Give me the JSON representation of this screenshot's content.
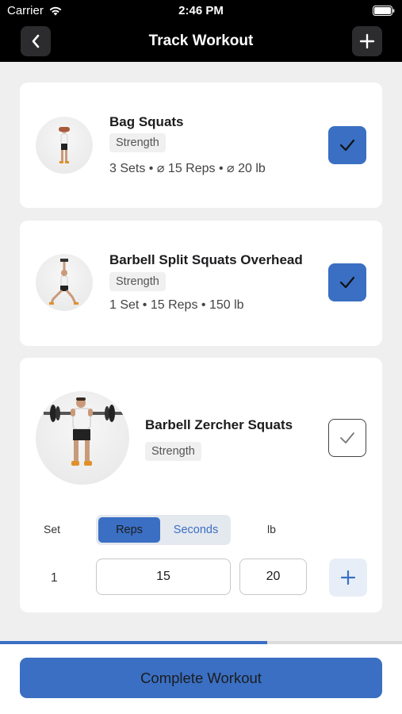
{
  "status_bar": {
    "carrier": "Carrier",
    "time": "2:46 PM"
  },
  "nav": {
    "title": "Track Workout"
  },
  "exercises": [
    {
      "name": "Bag Squats",
      "category": "Strength",
      "stats": "3 Sets • ⌀ 15 Reps • ⌀ 20 lb",
      "completed": true
    },
    {
      "name": "Barbell Split Squats Overhead",
      "category": "Strength",
      "stats": "1 Set • 15 Reps • 150 lb",
      "completed": true
    },
    {
      "name": "Barbell Zercher Squats",
      "category": "Strength",
      "completed": false,
      "sets_table": {
        "headers": {
          "set": "Set",
          "reps": "Reps",
          "seconds": "Seconds",
          "weight_unit": "lb"
        },
        "mode_selected": "Reps",
        "rows": [
          {
            "set": "1",
            "reps": "15",
            "weight": "20"
          }
        ]
      }
    }
  ],
  "progress": 0.665,
  "footer": {
    "complete_label": "Complete Workout"
  },
  "colors": {
    "accent": "#3a6fc3",
    "nav_bg": "#000000",
    "page_bg": "#efefef"
  },
  "icons": [
    "wifi-icon",
    "battery-icon",
    "chevron-left-icon",
    "plus-icon",
    "checkmark-icon"
  ]
}
